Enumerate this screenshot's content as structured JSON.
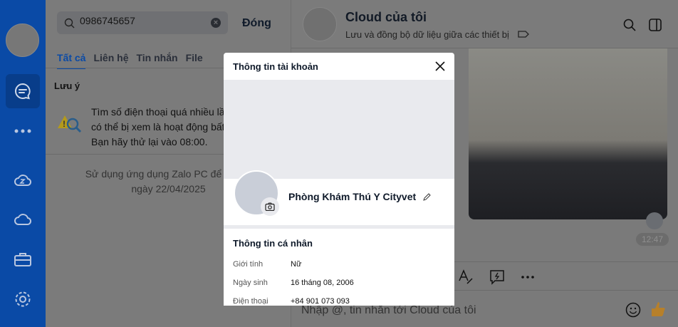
{
  "search": {
    "query": "0986745657",
    "close_label": "Đóng"
  },
  "tabs": [
    {
      "label": "Tất cả"
    },
    {
      "label": "Liên hệ"
    },
    {
      "label": "Tin nhắn"
    },
    {
      "label": "File"
    }
  ],
  "notice": {
    "title": "Lưu ý",
    "lines": [
      "Tìm số điện thoại quá nhiều lần",
      "có thể bị xem là hoạt động bất",
      "Bạn hãy thử lại vào 08:00."
    ]
  },
  "hint": {
    "lines": [
      "Sử dụng ứng dụng Zalo PC để tìm tin",
      "ngày 22/04/2025"
    ]
  },
  "chat": {
    "title": "Cloud của tôi",
    "subtitle": "Lưu và đồng bộ dữ liệu giữa các thiết bị",
    "time": "12:47",
    "composer_placeholder": "Nhập @, tin nhắn tới Cloud của tôi"
  },
  "modal": {
    "title": "Thông tin tài khoản",
    "name": "Phòng Khám Thú Y Cityvet",
    "section": "Thông tin cá nhân",
    "rows": [
      {
        "k": "Giới tính",
        "v": "Nữ"
      },
      {
        "k": "Ngày sinh",
        "v": "16 tháng 08, 2006"
      },
      {
        "k": "Điện thoại",
        "v": "+84 901 073 093"
      }
    ]
  },
  "colors": {
    "sidebar": "#0a4aa6",
    "overlay": "#7b7b7b"
  }
}
